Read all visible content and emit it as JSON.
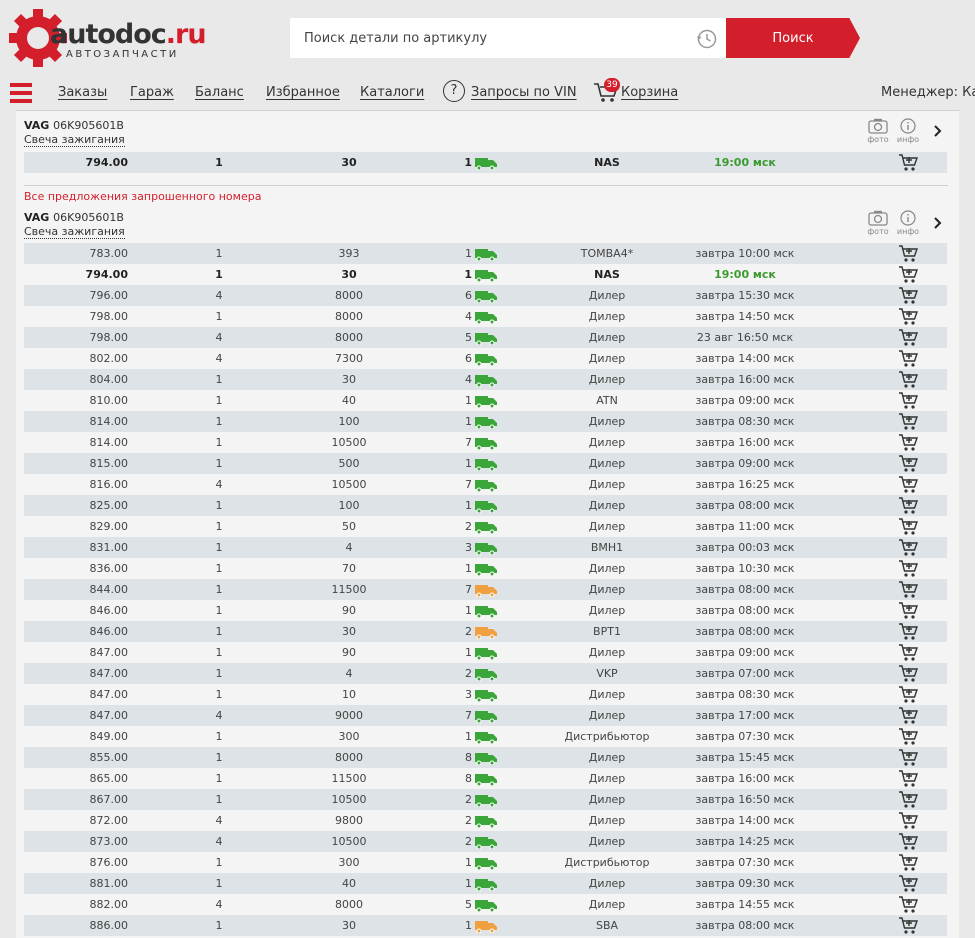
{
  "logo": {
    "main": "autodoc",
    "suffix": ".ru",
    "sub": "АВТОЗАПЧАСТИ"
  },
  "search": {
    "placeholder": "Поиск детали по артикулу",
    "button": "Поиск"
  },
  "nav": {
    "links": [
      "Заказы",
      "Гараж",
      "Баланс",
      "Избранное",
      "Каталоги"
    ],
    "vin": "Запросы по VIN",
    "cart": "Корзина",
    "cart_count": "39",
    "manager": "Менеджер: Каз"
  },
  "colors": {
    "accent": "#d31f2b",
    "green_truck": "#3aa63a",
    "orange_truck": "#f0a040",
    "row_alt": "#dde3e6"
  },
  "icons": {
    "photo": "camera-icon",
    "info": "info-icon",
    "cart": "cart-icon",
    "truck": "truck-icon",
    "history": "clock-icon"
  },
  "top_block": {
    "brand": "VAG",
    "article": "06K905601B",
    "name": "Свеча зажигания",
    "photo_label": "фото",
    "info_label": "инфо",
    "rows": [
      {
        "price": "794.00",
        "min": "1",
        "qty": "30",
        "days": "1",
        "truck": "green",
        "supplier": "NAS",
        "delivery": "19:00 мск",
        "bold": true,
        "green_delivery": true
      }
    ]
  },
  "section_title": "Все предложения запрошенного номера",
  "main_block": {
    "brand": "VAG",
    "article": "06K905601B",
    "name": "Свеча зажигания",
    "photo_label": "фото",
    "info_label": "инфо",
    "rows": [
      {
        "price": "783.00",
        "min": "1",
        "qty": "393",
        "days": "1",
        "truck": "green",
        "supplier": "TOMBA4*",
        "delivery": "завтра 10:00 мск"
      },
      {
        "price": "794.00",
        "min": "1",
        "qty": "30",
        "days": "1",
        "truck": "green",
        "supplier": "NAS",
        "delivery": "19:00 мск",
        "bold": true,
        "green_delivery": true
      },
      {
        "price": "796.00",
        "min": "4",
        "qty": "8000",
        "days": "6",
        "truck": "green",
        "supplier": "Дилер",
        "delivery": "завтра 15:30 мск"
      },
      {
        "price": "798.00",
        "min": "1",
        "qty": "8000",
        "days": "4",
        "truck": "green",
        "supplier": "Дилер",
        "delivery": "завтра 14:50 мск"
      },
      {
        "price": "798.00",
        "min": "4",
        "qty": "8000",
        "days": "5",
        "truck": "green",
        "supplier": "Дилер",
        "delivery": "23 авг 16:50 мск"
      },
      {
        "price": "802.00",
        "min": "4",
        "qty": "7300",
        "days": "6",
        "truck": "green",
        "supplier": "Дилер",
        "delivery": "завтра 14:00 мск"
      },
      {
        "price": "804.00",
        "min": "1",
        "qty": "30",
        "days": "4",
        "truck": "green",
        "supplier": "Дилер",
        "delivery": "завтра 16:00 мск"
      },
      {
        "price": "810.00",
        "min": "1",
        "qty": "40",
        "days": "1",
        "truck": "green",
        "supplier": "ATN",
        "delivery": "завтра 09:00 мск"
      },
      {
        "price": "814.00",
        "min": "1",
        "qty": "100",
        "days": "1",
        "truck": "green",
        "supplier": "Дилер",
        "delivery": "завтра 08:30 мск"
      },
      {
        "price": "814.00",
        "min": "1",
        "qty": "10500",
        "days": "7",
        "truck": "green",
        "supplier": "Дилер",
        "delivery": "завтра 16:00 мск"
      },
      {
        "price": "815.00",
        "min": "1",
        "qty": "500",
        "days": "1",
        "truck": "green",
        "supplier": "Дилер",
        "delivery": "завтра 09:00 мск"
      },
      {
        "price": "816.00",
        "min": "4",
        "qty": "10500",
        "days": "7",
        "truck": "green",
        "supplier": "Дилер",
        "delivery": "завтра 16:25 мск"
      },
      {
        "price": "825.00",
        "min": "1",
        "qty": "100",
        "days": "1",
        "truck": "green",
        "supplier": "Дилер",
        "delivery": "завтра 08:00 мск"
      },
      {
        "price": "829.00",
        "min": "1",
        "qty": "50",
        "days": "2",
        "truck": "green",
        "supplier": "Дилер",
        "delivery": "завтра 11:00 мск"
      },
      {
        "price": "831.00",
        "min": "1",
        "qty": "4",
        "days": "3",
        "truck": "green",
        "supplier": "BMH1",
        "delivery": "завтра 00:03 мск"
      },
      {
        "price": "836.00",
        "min": "1",
        "qty": "70",
        "days": "1",
        "truck": "green",
        "supplier": "Дилер",
        "delivery": "завтра 10:30 мск"
      },
      {
        "price": "844.00",
        "min": "1",
        "qty": "11500",
        "days": "7",
        "truck": "orange",
        "supplier": "Дилер",
        "delivery": "завтра 08:00 мск"
      },
      {
        "price": "846.00",
        "min": "1",
        "qty": "90",
        "days": "1",
        "truck": "green",
        "supplier": "Дилер",
        "delivery": "завтра 08:00 мск"
      },
      {
        "price": "846.00",
        "min": "1",
        "qty": "30",
        "days": "2",
        "truck": "orange",
        "supplier": "BPT1",
        "delivery": "завтра 08:00 мск"
      },
      {
        "price": "847.00",
        "min": "1",
        "qty": "90",
        "days": "1",
        "truck": "green",
        "supplier": "Дилер",
        "delivery": "завтра 09:00 мск"
      },
      {
        "price": "847.00",
        "min": "1",
        "qty": "4",
        "days": "2",
        "truck": "green",
        "supplier": "VKP",
        "delivery": "завтра 07:00 мск"
      },
      {
        "price": "847.00",
        "min": "1",
        "qty": "10",
        "days": "3",
        "truck": "green",
        "supplier": "Дилер",
        "delivery": "завтра 08:30 мск"
      },
      {
        "price": "847.00",
        "min": "4",
        "qty": "9000",
        "days": "7",
        "truck": "green",
        "supplier": "Дилер",
        "delivery": "завтра 17:00 мск"
      },
      {
        "price": "849.00",
        "min": "1",
        "qty": "300",
        "days": "1",
        "truck": "green",
        "supplier": "Дистрибьютор",
        "delivery": "завтра 07:30 мск"
      },
      {
        "price": "855.00",
        "min": "1",
        "qty": "8000",
        "days": "8",
        "truck": "green",
        "supplier": "Дилер",
        "delivery": "завтра 15:45 мск"
      },
      {
        "price": "865.00",
        "min": "1",
        "qty": "11500",
        "days": "8",
        "truck": "green",
        "supplier": "Дилер",
        "delivery": "завтра 16:00 мск"
      },
      {
        "price": "867.00",
        "min": "1",
        "qty": "10500",
        "days": "2",
        "truck": "green",
        "supplier": "Дилер",
        "delivery": "завтра 16:50 мск"
      },
      {
        "price": "872.00",
        "min": "4",
        "qty": "9800",
        "days": "2",
        "truck": "green",
        "supplier": "Дилер",
        "delivery": "завтра 14:00 мск"
      },
      {
        "price": "873.00",
        "min": "4",
        "qty": "10500",
        "days": "2",
        "truck": "green",
        "supplier": "Дилер",
        "delivery": "завтра 14:25 мск"
      },
      {
        "price": "876.00",
        "min": "1",
        "qty": "300",
        "days": "1",
        "truck": "green",
        "supplier": "Дистрибьютор",
        "delivery": "завтра 07:30 мск"
      },
      {
        "price": "881.00",
        "min": "1",
        "qty": "40",
        "days": "1",
        "truck": "green",
        "supplier": "Дилер",
        "delivery": "завтра 09:30 мск"
      },
      {
        "price": "882.00",
        "min": "4",
        "qty": "8000",
        "days": "5",
        "truck": "green",
        "supplier": "Дилер",
        "delivery": "завтра 14:55 мск"
      },
      {
        "price": "886.00",
        "min": "1",
        "qty": "30",
        "days": "1",
        "truck": "orange",
        "supplier": "SBA",
        "delivery": "завтра 08:00 мск"
      }
    ]
  }
}
